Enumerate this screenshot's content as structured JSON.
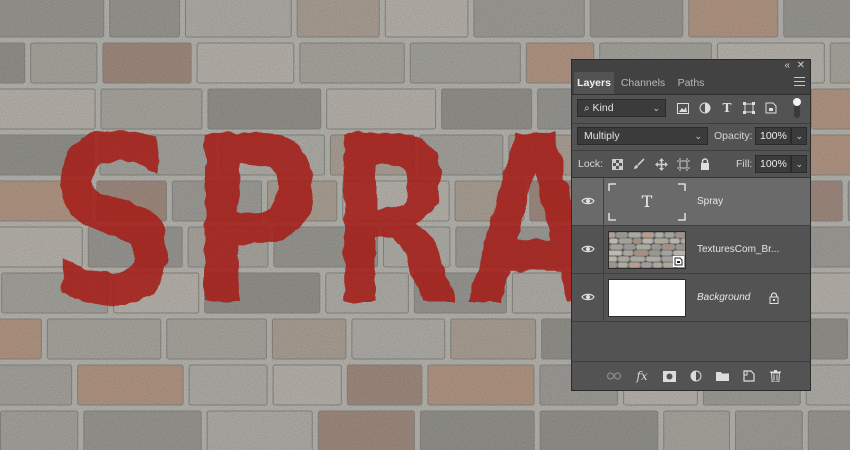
{
  "canvas": {
    "artwork_text": "SPRAY",
    "spray_color": "#b8221d"
  },
  "panel": {
    "tabs": [
      {
        "label": "Layers",
        "active": true
      },
      {
        "label": "Channels",
        "active": false
      },
      {
        "label": "Paths",
        "active": false
      }
    ],
    "filter": {
      "label": "Kind"
    },
    "blend_mode": "Multiply",
    "opacity": {
      "label": "Opacity:",
      "value": "100%"
    },
    "lock": {
      "label": "Lock:"
    },
    "fill": {
      "label": "Fill:",
      "value": "100%"
    },
    "layers": [
      {
        "name": "Spray",
        "kind": "text",
        "selected": true,
        "thumb_glyph": "T"
      },
      {
        "name": "TexturesCom_Br...",
        "kind": "smart-object",
        "selected": false
      },
      {
        "name": "Background",
        "kind": "background",
        "selected": false,
        "locked": true
      }
    ]
  }
}
